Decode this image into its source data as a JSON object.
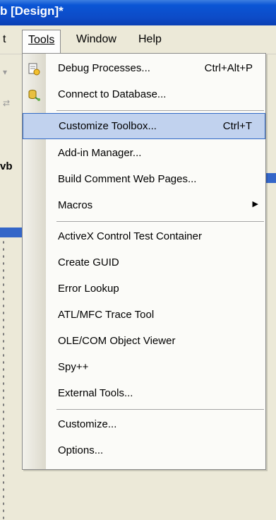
{
  "window": {
    "title": "b [Design]*"
  },
  "menubar": {
    "items": [
      {
        "label": "t"
      },
      {
        "label": "Tools"
      },
      {
        "label": "Window"
      },
      {
        "label": "Help"
      }
    ]
  },
  "sidebar": {
    "label": "vb"
  },
  "tools_menu": {
    "items": [
      {
        "label": "Debug Processes...",
        "shortcut": "Ctrl+Alt+P",
        "icon": "debug-processes-icon"
      },
      {
        "label": "Connect to Database...",
        "icon": "connect-database-icon"
      },
      {
        "label": "Customize Toolbox...",
        "shortcut": "Ctrl+T"
      },
      {
        "label": "Add-in Manager..."
      },
      {
        "label": "Build Comment Web Pages..."
      },
      {
        "label": "Macros",
        "submenu": true
      },
      {
        "label": "ActiveX Control Test Container"
      },
      {
        "label": "Create GUID"
      },
      {
        "label": "Error Lookup"
      },
      {
        "label": "ATL/MFC Trace Tool"
      },
      {
        "label": "OLE/COM Object Viewer"
      },
      {
        "label": "Spy++"
      },
      {
        "label": "External Tools..."
      },
      {
        "label": "Customize..."
      },
      {
        "label": "Options..."
      }
    ],
    "selected_index": 2,
    "selected_color": "#c1d2ee",
    "selected_border": "#316ac5"
  }
}
